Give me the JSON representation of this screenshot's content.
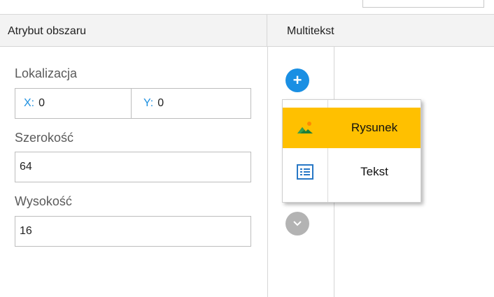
{
  "left_panel": {
    "header": "Atrybut obszaru",
    "location_label": "Lokalizacja",
    "x_key": "X:",
    "x_value": "0",
    "y_key": "Y:",
    "y_value": "0",
    "width_label": "Szerokość",
    "width_value": "64",
    "height_label": "Wysokość",
    "height_value": "16"
  },
  "right_panel": {
    "header": "Multitekst",
    "add_icon": "plus-icon",
    "down_icon": "chevron-down-icon",
    "menu": [
      {
        "label": "Rysunek",
        "icon": "image-icon",
        "active": true
      },
      {
        "label": "Tekst",
        "icon": "text-list-icon",
        "active": false
      }
    ]
  },
  "colors": {
    "accent_blue": "#1a8fe3",
    "highlight": "#ffc000",
    "header_bg": "#f3f3f3"
  }
}
